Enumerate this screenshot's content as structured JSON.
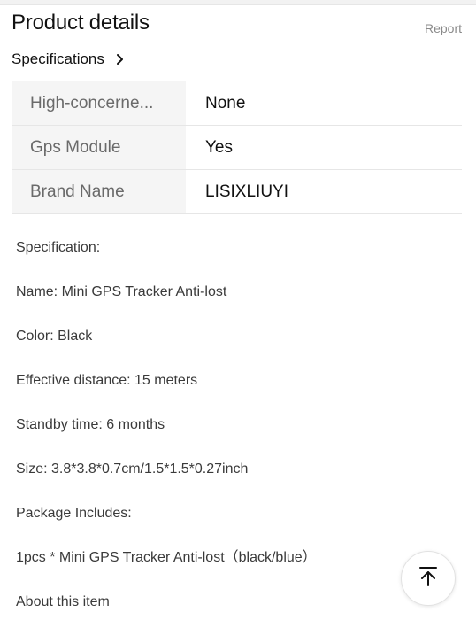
{
  "header": {
    "title": "Product details",
    "report_label": "Report"
  },
  "specifications": {
    "link_label": "Specifications",
    "link_icon": "chevron-right-icon",
    "rows": [
      {
        "key": "High-concerne...",
        "value": "None"
      },
      {
        "key": "Gps Module",
        "value": "Yes"
      },
      {
        "key": "Brand Name",
        "value": "LISIXLIUYI"
      }
    ]
  },
  "description": {
    "lines": [
      "Specification:",
      "Name: Mini GPS Tracker Anti-lost",
      "Color: Black",
      "Effective distance: 15 meters",
      "Standby time: 6 months",
      "Size: 3.8*3.8*0.7cm/1.5*1.5*0.27inch",
      "Package Includes:",
      "1pcs * Mini GPS Tracker Anti-lost（black/blue）",
      "About this item"
    ]
  },
  "back_to_top": {
    "icon": "arrow-up-to-top-icon"
  }
}
